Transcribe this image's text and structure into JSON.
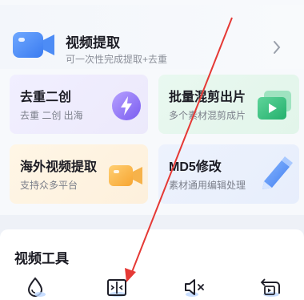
{
  "hero": {
    "title": "视频提取",
    "subtitle": "可一次性完成提取+去重",
    "icon": "video-camera-icon"
  },
  "cards": [
    {
      "title": "去重二创",
      "subtitle": "去重  二创  出海",
      "icon": "lightning-icon"
    },
    {
      "title": "批量混剪出片",
      "subtitle": "多个素材混剪成片",
      "icon": "play-stack-icon"
    },
    {
      "title": "海外视频提取",
      "subtitle": "支持众多平台",
      "icon": "video-camera-icon"
    },
    {
      "title": "MD5修改",
      "subtitle": "素材通用编辑处理",
      "icon": "pencil-icon"
    }
  ],
  "tools": {
    "title": "视频工具",
    "items": [
      {
        "icon": "watermark-drop-icon"
      },
      {
        "icon": "compress-icon"
      },
      {
        "icon": "mute-icon"
      },
      {
        "icon": "reverse-icon"
      }
    ]
  },
  "annotation": {
    "type": "arrow",
    "color": "#e53935"
  }
}
